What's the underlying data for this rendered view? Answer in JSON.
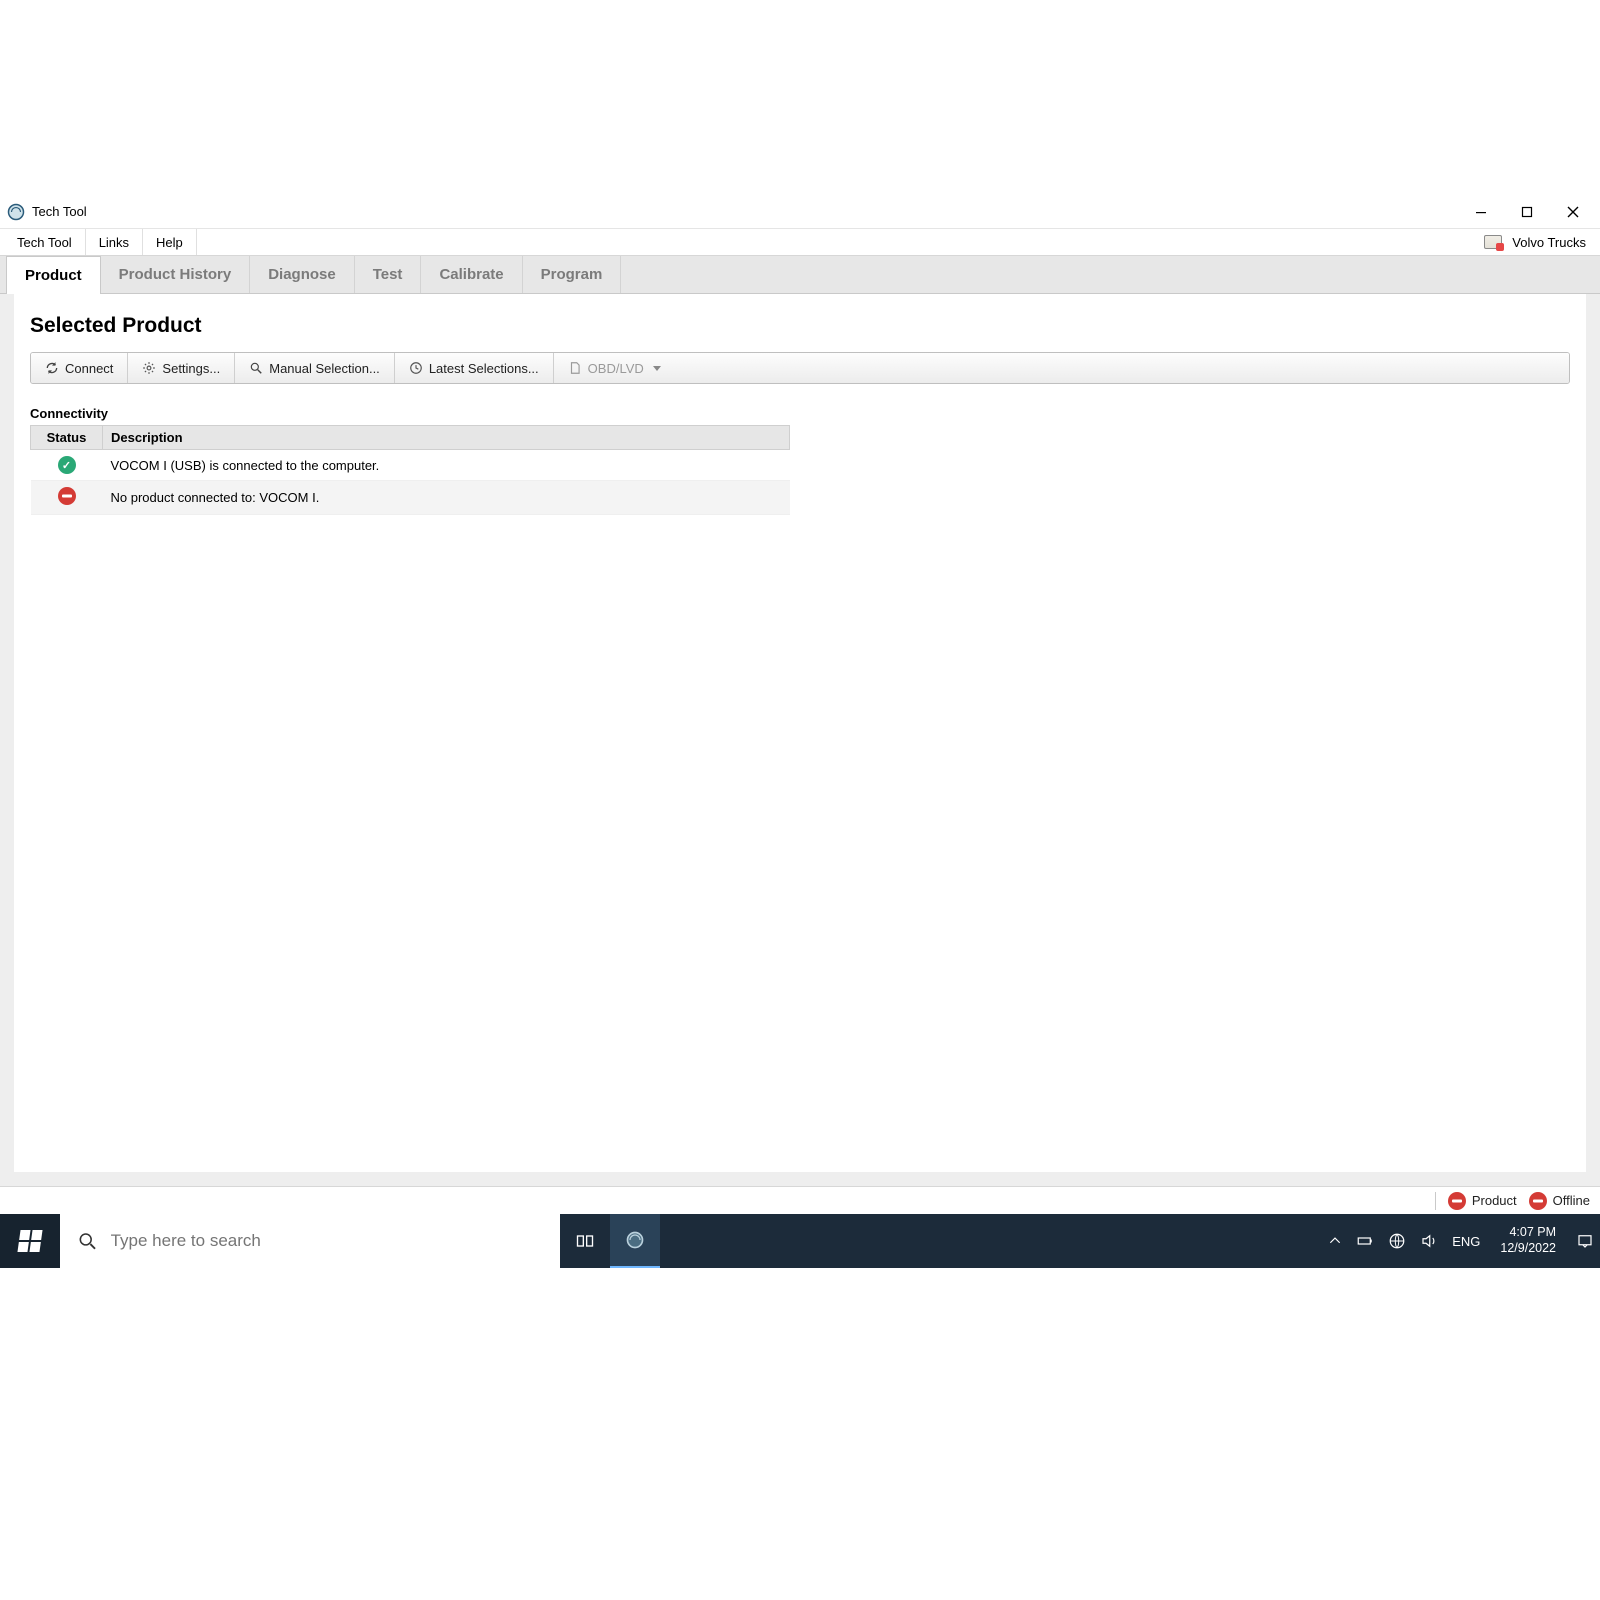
{
  "window": {
    "title": "Tech Tool"
  },
  "menu": {
    "items": [
      "Tech Tool",
      "Links",
      "Help"
    ],
    "brand": "Volvo Trucks"
  },
  "tabs": {
    "items": [
      "Product",
      "Product History",
      "Diagnose",
      "Test",
      "Calibrate",
      "Program"
    ],
    "active_index": 0
  },
  "page": {
    "title": "Selected Product"
  },
  "toolbar": {
    "connect": "Connect",
    "settings": "Settings...",
    "manual": "Manual Selection...",
    "latest": "Latest Selections...",
    "obd": "OBD/LVD"
  },
  "connectivity": {
    "section_label": "Connectivity",
    "headers": {
      "status": "Status",
      "description": "Description"
    },
    "rows": [
      {
        "status": "ok",
        "description": "VOCOM I (USB) is connected to the computer."
      },
      {
        "status": "err",
        "description": "No product connected to: VOCOM I."
      }
    ]
  },
  "statusbar": {
    "product": "Product",
    "offline": "Offline"
  },
  "taskbar": {
    "search_placeholder": "Type here to search",
    "lang": "ENG",
    "time": "4:07 PM",
    "date": "12/9/2022"
  }
}
